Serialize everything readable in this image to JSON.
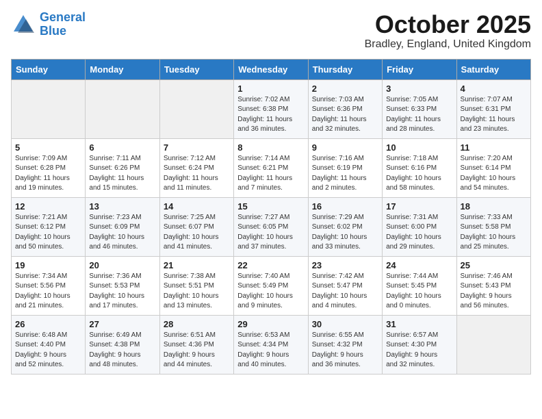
{
  "logo": {
    "line1": "General",
    "line2": "Blue"
  },
  "title": "October 2025",
  "location": "Bradley, England, United Kingdom",
  "days_of_week": [
    "Sunday",
    "Monday",
    "Tuesday",
    "Wednesday",
    "Thursday",
    "Friday",
    "Saturday"
  ],
  "weeks": [
    [
      {
        "day": "",
        "info": ""
      },
      {
        "day": "",
        "info": ""
      },
      {
        "day": "",
        "info": ""
      },
      {
        "day": "1",
        "info": "Sunrise: 7:02 AM\nSunset: 6:38 PM\nDaylight: 11 hours\nand 36 minutes."
      },
      {
        "day": "2",
        "info": "Sunrise: 7:03 AM\nSunset: 6:36 PM\nDaylight: 11 hours\nand 32 minutes."
      },
      {
        "day": "3",
        "info": "Sunrise: 7:05 AM\nSunset: 6:33 PM\nDaylight: 11 hours\nand 28 minutes."
      },
      {
        "day": "4",
        "info": "Sunrise: 7:07 AM\nSunset: 6:31 PM\nDaylight: 11 hours\nand 23 minutes."
      }
    ],
    [
      {
        "day": "5",
        "info": "Sunrise: 7:09 AM\nSunset: 6:28 PM\nDaylight: 11 hours\nand 19 minutes."
      },
      {
        "day": "6",
        "info": "Sunrise: 7:11 AM\nSunset: 6:26 PM\nDaylight: 11 hours\nand 15 minutes."
      },
      {
        "day": "7",
        "info": "Sunrise: 7:12 AM\nSunset: 6:24 PM\nDaylight: 11 hours\nand 11 minutes."
      },
      {
        "day": "8",
        "info": "Sunrise: 7:14 AM\nSunset: 6:21 PM\nDaylight: 11 hours\nand 7 minutes."
      },
      {
        "day": "9",
        "info": "Sunrise: 7:16 AM\nSunset: 6:19 PM\nDaylight: 11 hours\nand 2 minutes."
      },
      {
        "day": "10",
        "info": "Sunrise: 7:18 AM\nSunset: 6:16 PM\nDaylight: 10 hours\nand 58 minutes."
      },
      {
        "day": "11",
        "info": "Sunrise: 7:20 AM\nSunset: 6:14 PM\nDaylight: 10 hours\nand 54 minutes."
      }
    ],
    [
      {
        "day": "12",
        "info": "Sunrise: 7:21 AM\nSunset: 6:12 PM\nDaylight: 10 hours\nand 50 minutes."
      },
      {
        "day": "13",
        "info": "Sunrise: 7:23 AM\nSunset: 6:09 PM\nDaylight: 10 hours\nand 46 minutes."
      },
      {
        "day": "14",
        "info": "Sunrise: 7:25 AM\nSunset: 6:07 PM\nDaylight: 10 hours\nand 41 minutes."
      },
      {
        "day": "15",
        "info": "Sunrise: 7:27 AM\nSunset: 6:05 PM\nDaylight: 10 hours\nand 37 minutes."
      },
      {
        "day": "16",
        "info": "Sunrise: 7:29 AM\nSunset: 6:02 PM\nDaylight: 10 hours\nand 33 minutes."
      },
      {
        "day": "17",
        "info": "Sunrise: 7:31 AM\nSunset: 6:00 PM\nDaylight: 10 hours\nand 29 minutes."
      },
      {
        "day": "18",
        "info": "Sunrise: 7:33 AM\nSunset: 5:58 PM\nDaylight: 10 hours\nand 25 minutes."
      }
    ],
    [
      {
        "day": "19",
        "info": "Sunrise: 7:34 AM\nSunset: 5:56 PM\nDaylight: 10 hours\nand 21 minutes."
      },
      {
        "day": "20",
        "info": "Sunrise: 7:36 AM\nSunset: 5:53 PM\nDaylight: 10 hours\nand 17 minutes."
      },
      {
        "day": "21",
        "info": "Sunrise: 7:38 AM\nSunset: 5:51 PM\nDaylight: 10 hours\nand 13 minutes."
      },
      {
        "day": "22",
        "info": "Sunrise: 7:40 AM\nSunset: 5:49 PM\nDaylight: 10 hours\nand 9 minutes."
      },
      {
        "day": "23",
        "info": "Sunrise: 7:42 AM\nSunset: 5:47 PM\nDaylight: 10 hours\nand 4 minutes."
      },
      {
        "day": "24",
        "info": "Sunrise: 7:44 AM\nSunset: 5:45 PM\nDaylight: 10 hours\nand 0 minutes."
      },
      {
        "day": "25",
        "info": "Sunrise: 7:46 AM\nSunset: 5:43 PM\nDaylight: 9 hours\nand 56 minutes."
      }
    ],
    [
      {
        "day": "26",
        "info": "Sunrise: 6:48 AM\nSunset: 4:40 PM\nDaylight: 9 hours\nand 52 minutes."
      },
      {
        "day": "27",
        "info": "Sunrise: 6:49 AM\nSunset: 4:38 PM\nDaylight: 9 hours\nand 48 minutes."
      },
      {
        "day": "28",
        "info": "Sunrise: 6:51 AM\nSunset: 4:36 PM\nDaylight: 9 hours\nand 44 minutes."
      },
      {
        "day": "29",
        "info": "Sunrise: 6:53 AM\nSunset: 4:34 PM\nDaylight: 9 hours\nand 40 minutes."
      },
      {
        "day": "30",
        "info": "Sunrise: 6:55 AM\nSunset: 4:32 PM\nDaylight: 9 hours\nand 36 minutes."
      },
      {
        "day": "31",
        "info": "Sunrise: 6:57 AM\nSunset: 4:30 PM\nDaylight: 9 hours\nand 32 minutes."
      },
      {
        "day": "",
        "info": ""
      }
    ]
  ]
}
